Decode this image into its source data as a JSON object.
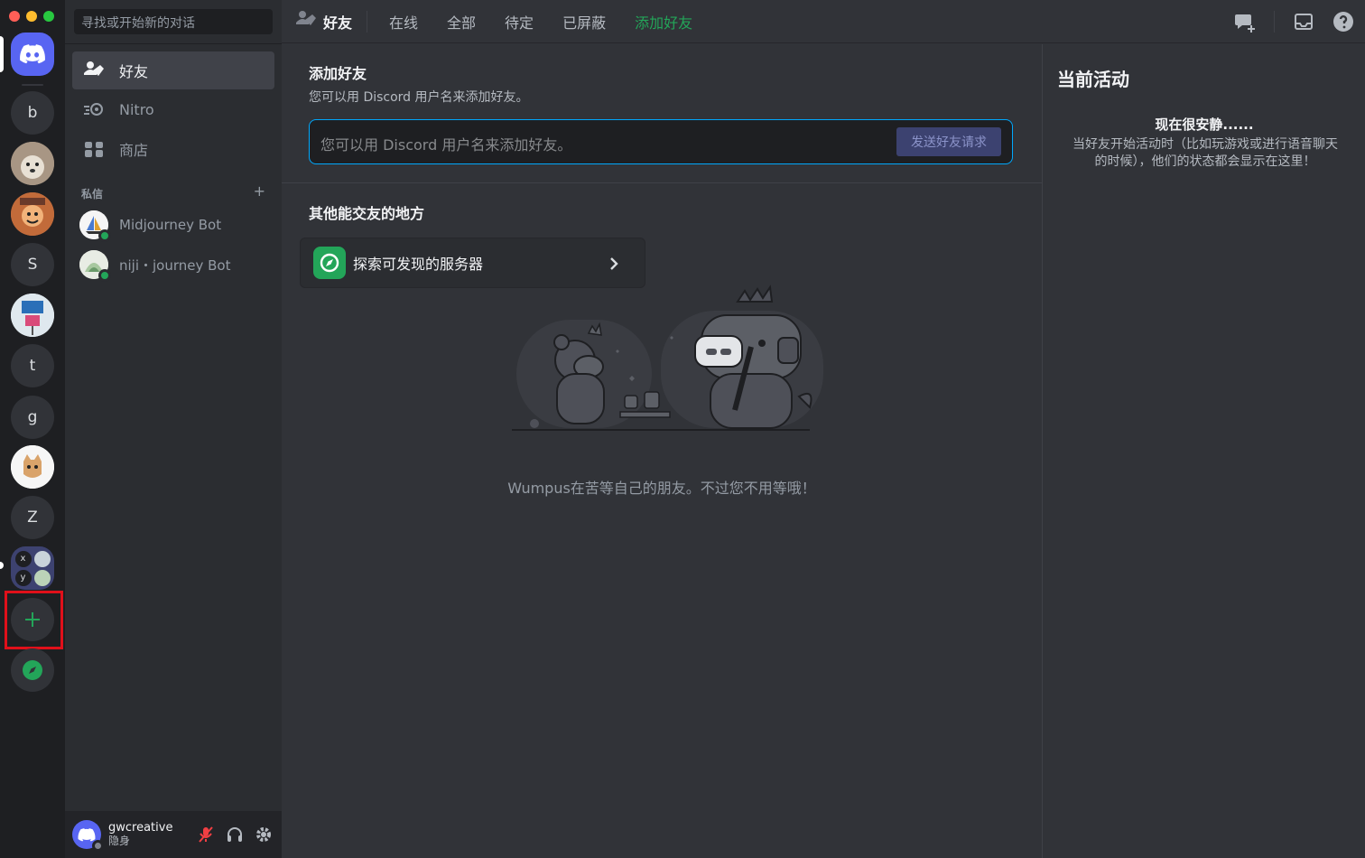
{
  "window": {
    "traffic_colors": [
      "#ff5f57",
      "#febc2e",
      "#28c840"
    ]
  },
  "servers": {
    "items": [
      {
        "label": "b"
      },
      {
        "label": "S"
      },
      {
        "label": "t"
      },
      {
        "label": "g"
      },
      {
        "label": "Z"
      }
    ],
    "folder_letters": [
      "x",
      "y"
    ],
    "add_server_icon": "plus-icon",
    "explore_icon": "compass-icon"
  },
  "sidebar": {
    "search_placeholder": "寻找或开始新的对话",
    "nav": [
      {
        "label": "好友",
        "icon": "friends-icon"
      },
      {
        "label": "Nitro",
        "icon": "nitro-icon"
      },
      {
        "label": "商店",
        "icon": "shop-icon"
      }
    ],
    "dm_header": "私信",
    "dm_add": "+",
    "dms": [
      {
        "name": "Midjourney Bot"
      },
      {
        "name": "niji・journey Bot"
      }
    ]
  },
  "user": {
    "name": "gwcreative",
    "status": "隐身"
  },
  "topbar": {
    "title": "好友",
    "tabs": [
      "在线",
      "全部",
      "待定",
      "已屏蔽"
    ],
    "add_friend_tab": "添加好友"
  },
  "add_friend": {
    "title": "添加好友",
    "subtitle": "您可以用 Discord 用户名来添加好友。",
    "input_placeholder": "您可以用 Discord 用户名来添加好友。",
    "send_button": "发送好友请求"
  },
  "other_places": {
    "title": "其他能交友的地方",
    "explore_label": "探索可发现的服务器"
  },
  "empty_state": "Wumpus在苦等自己的朋友。不过您不用等哦！",
  "activity": {
    "title": "当前活动",
    "quiet_title": "现在很安静......",
    "quiet_desc": "当好友开始活动时（比如玩游戏或进行语音聊天的时候），他们的状态都会显示在这里！"
  },
  "colors": {
    "accent": "#5865f2",
    "green": "#23a559",
    "highlight_box": "#e0101a"
  }
}
